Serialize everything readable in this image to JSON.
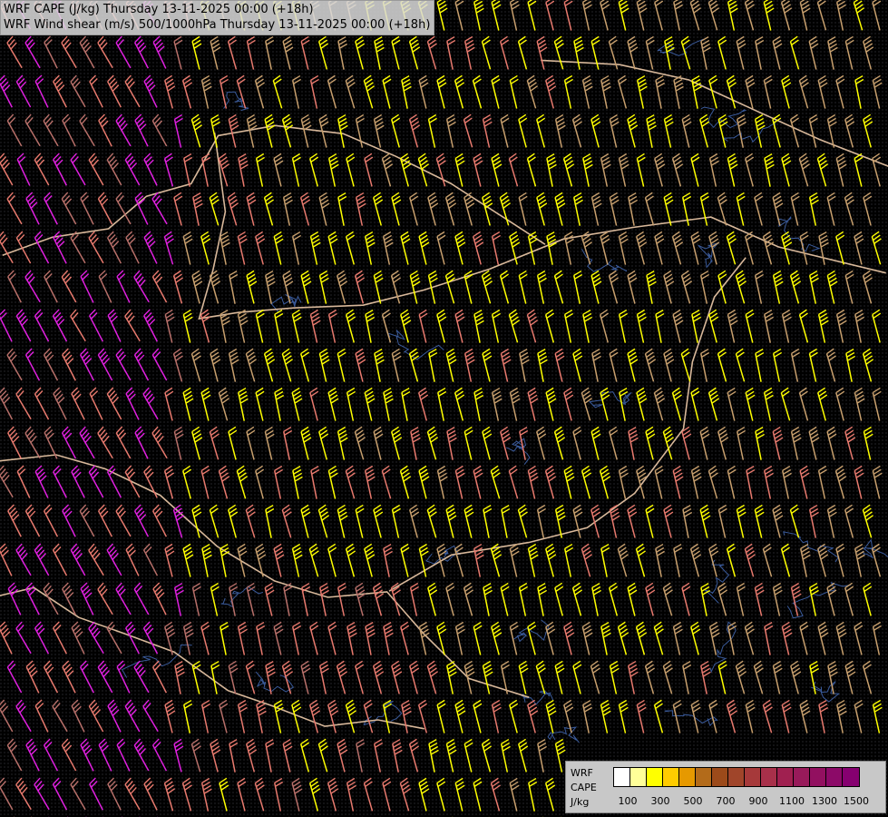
{
  "titles": {
    "line1": "WRF CAPE (J/kg) Thursday 13-11-2025 00:00 (+18h)",
    "line2": "WRF Wind shear (m/s) 500/1000hPa Thursday 13-11-2025 00:00 (+18h)"
  },
  "legend": {
    "label_model": "WRF",
    "label_var": "CAPE",
    "label_unit": "J/kg",
    "colors": [
      "#ffffff",
      "#ffff99",
      "#ffff00",
      "#ffcc00",
      "#e69900",
      "#b36b1a",
      "#9c4a1a",
      "#a0452a",
      "#a6393a",
      "#a8304a",
      "#a02050",
      "#981a5a",
      "#921060",
      "#8c0a68",
      "#860070"
    ],
    "ticks": [
      "100",
      "300",
      "500",
      "700",
      "900",
      "1100",
      "1300",
      "1500"
    ]
  },
  "barb_palette": {
    "yellow": "#ffff00",
    "tan": "#c8a06e",
    "salmon": "#e87a6e",
    "magenta": "#e020e0",
    "rosy": "#b8706a"
  },
  "border_color": "#d8b89a",
  "river_color": "#3a5a9a"
}
